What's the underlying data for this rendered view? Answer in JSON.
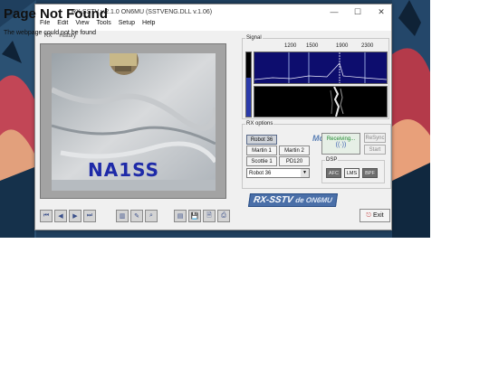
{
  "page": {
    "error_title": "Page Not Found",
    "error_message": "The webpage could not be found",
    "banner_colors": [
      "#21415f",
      "#b43a4a",
      "#e8a07a"
    ]
  },
  "window": {
    "title": "RX-SSTV v.2.1.0 ON6MU (SSTVENG.DLL v.1.06)",
    "controls": {
      "minimize": "—",
      "maximize": "☐",
      "close": "✕"
    },
    "menu": [
      "File",
      "Edit",
      "View",
      "Tools",
      "Setup",
      "Help"
    ],
    "toolbar": [
      "RX",
      "History"
    ]
  },
  "image": {
    "callsign": "NA1SS",
    "nav_buttons": [
      "⏮",
      "◀",
      "▶",
      "⏭"
    ],
    "tool_buttons": [
      "▥",
      "✎",
      "⌕"
    ],
    "file_buttons": [
      "▤",
      "💾",
      "🗎",
      "⎙"
    ]
  },
  "signal": {
    "label": "Signal",
    "freq_ticks": [
      "1200",
      "1500",
      "1900",
      "2300"
    ],
    "level": 0.6
  },
  "rx_options": {
    "label": "RX options",
    "modes_label": "Modes",
    "modes": [
      "Robot 36",
      "Martin 1",
      "Martin 2",
      "Scottie 1",
      "PD120"
    ],
    "selected_mode": "Robot 36",
    "receiving": "Receiving...",
    "resync": "ReSync",
    "start": "Start",
    "dsp_label": "DSP",
    "dsp_buttons": [
      "AFC",
      "LMS",
      "BPF"
    ]
  },
  "footer": {
    "logo": "RX-SSTV",
    "logo_suffix": "de ON6MU",
    "exit": "Exit"
  },
  "colors": {
    "spectrum_bg": "#0d0d6e",
    "callsign": "#1e2aa8",
    "receiving": "#1e8a2e"
  }
}
